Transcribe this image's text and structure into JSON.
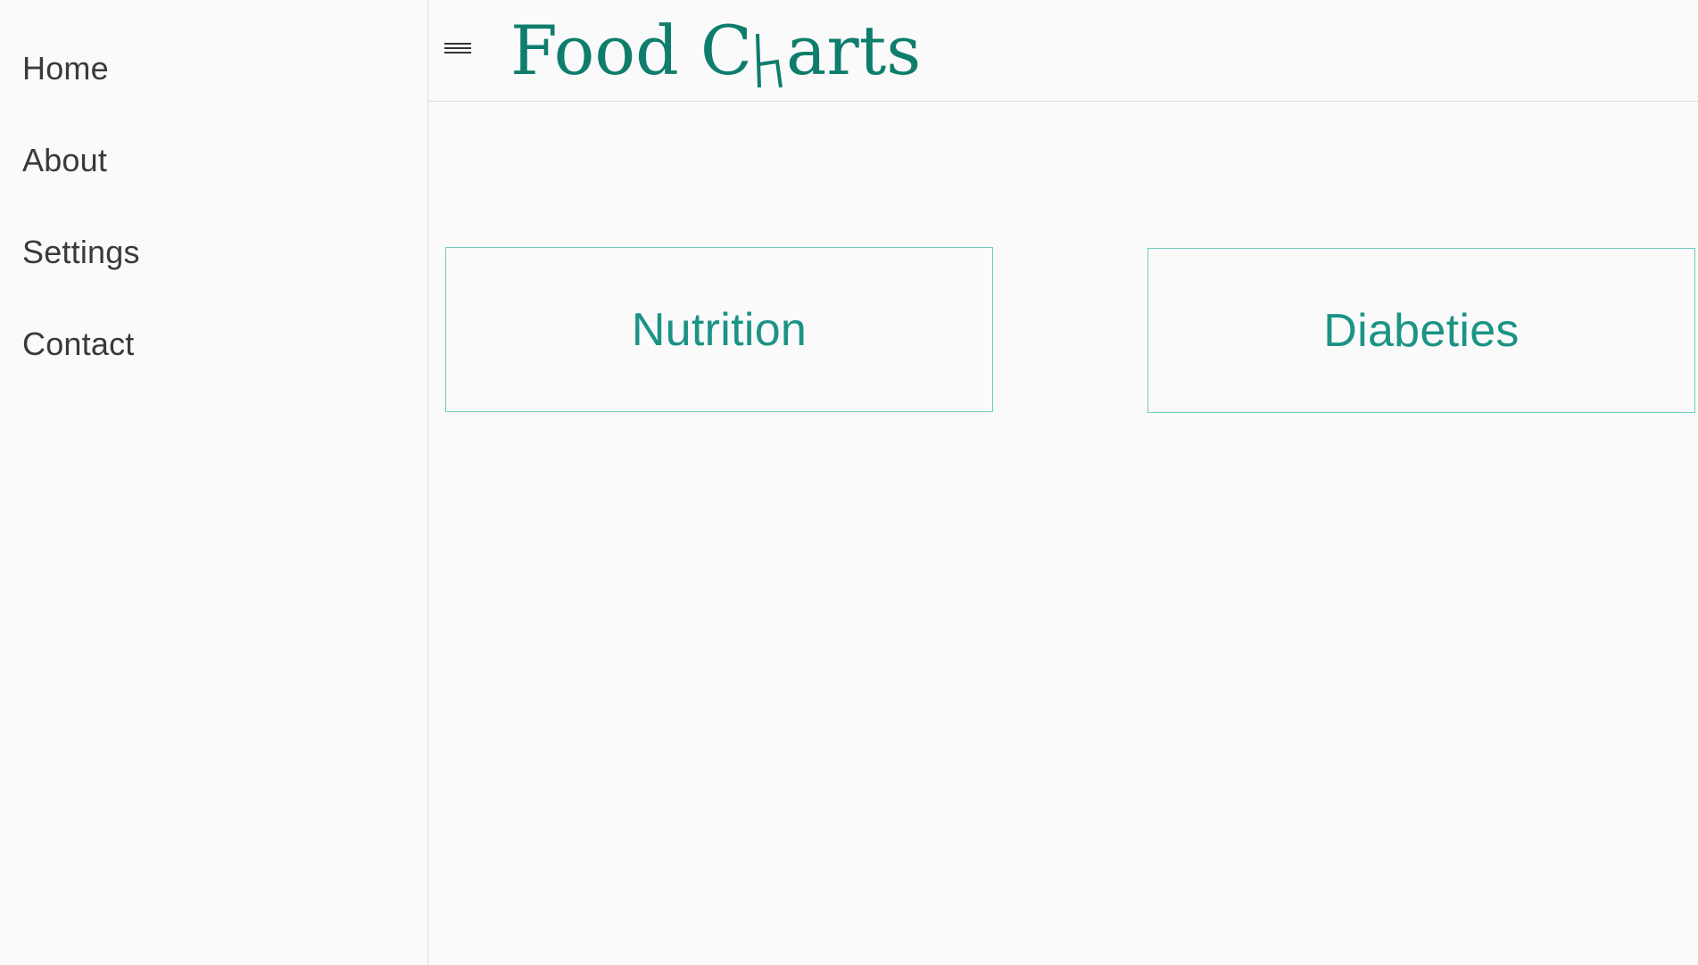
{
  "sidebar": {
    "items": [
      {
        "label": "Home"
      },
      {
        "label": "About"
      },
      {
        "label": "Settings"
      },
      {
        "label": "Contact"
      }
    ]
  },
  "header": {
    "menu_icon": "hamburger-menu-icon",
    "logo": {
      "before": "Food C",
      "after": "arts"
    }
  },
  "main": {
    "cards": [
      {
        "label": "Nutrition"
      },
      {
        "label": "Diabeties"
      }
    ]
  },
  "colors": {
    "brand": "#0e7d6c",
    "card_text": "#1b9385",
    "card_border": "#6ccdbf",
    "background": "#fafafa"
  }
}
